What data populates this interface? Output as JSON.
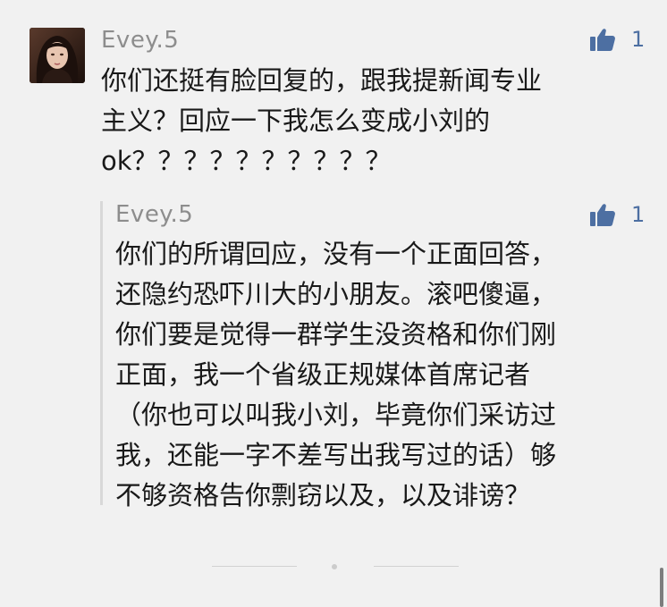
{
  "comment": {
    "author": "Evey.5",
    "likes": "1",
    "lines": [
      "你们还挺有脸回复的，跟我提新闻专业",
      "主义？回应一下我怎么变成小刘的",
      "ok？？？？？？？？？？"
    ]
  },
  "reply": {
    "author": "Evey.5",
    "likes": "1",
    "lines": [
      "你们的所谓回应，没有一个正面回答，",
      "还隐约恐吓川大的小朋友。滚吧傻逼，",
      "你们要是觉得一群学生没资格和你们刚",
      "正面，我一个省级正规媒体首席记者",
      "（你也可以叫我小刘，毕竟你们采访过",
      "我，还能一字不差写出我写过的话）够",
      "不够资格告你剽窃以及，以及诽谤？"
    ]
  },
  "icons": {
    "like": "thumbs-up-icon",
    "avatar": "avatar-photo"
  },
  "colors": {
    "background": "#f1f1f1",
    "username": "#8d8d8d",
    "like_accent": "#4d6fa2",
    "text": "#191919"
  }
}
